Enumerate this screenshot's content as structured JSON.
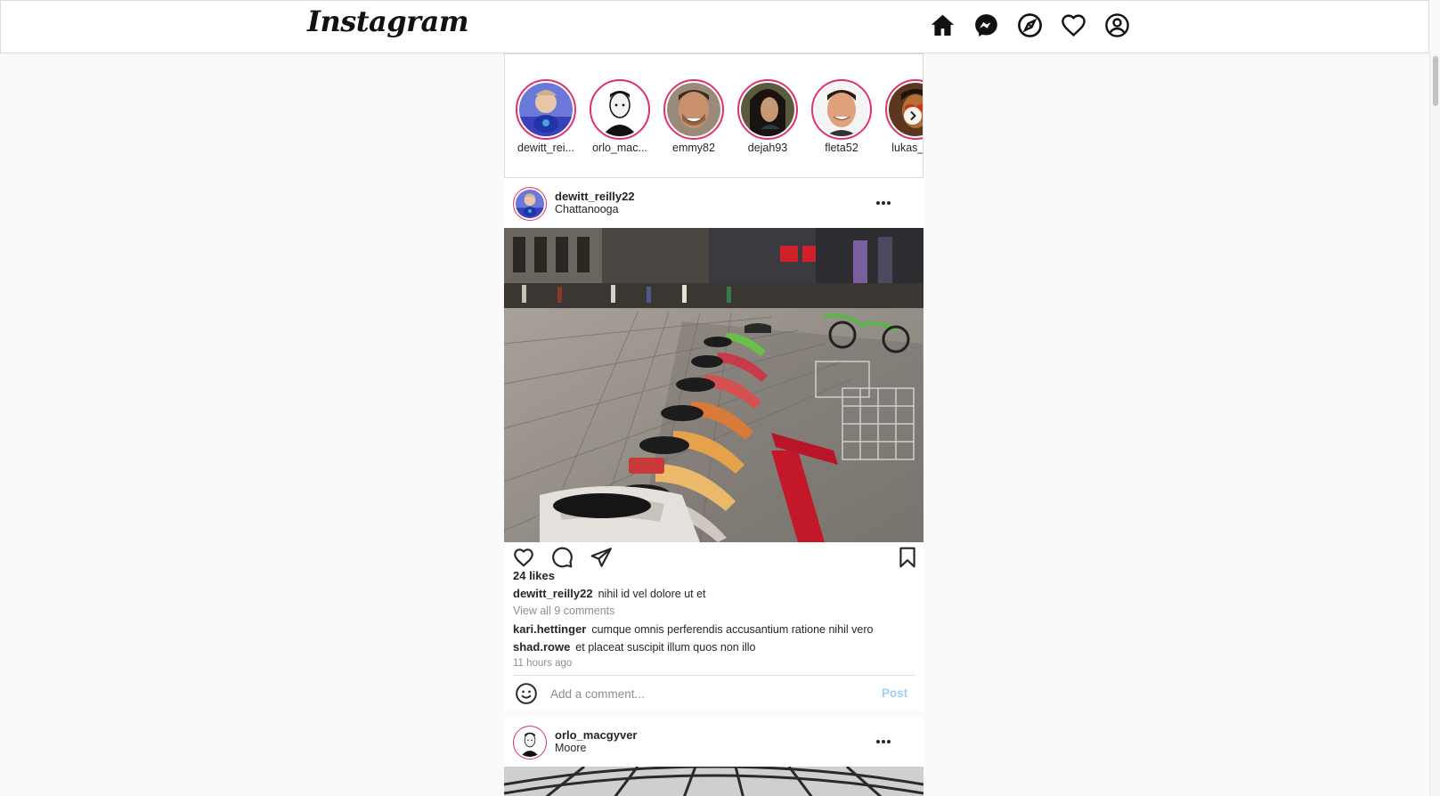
{
  "navbar": {
    "logo": "Instagram",
    "icons": [
      "home-icon",
      "messenger-icon",
      "explore-icon",
      "activity-heart-icon",
      "profile-icon"
    ]
  },
  "stories": [
    {
      "username": "dewitt_rei..."
    },
    {
      "username": "orlo_mac..."
    },
    {
      "username": "emmy82"
    },
    {
      "username": "dejah93"
    },
    {
      "username": "fleta52"
    },
    {
      "username": "lukas_o..."
    }
  ],
  "posts": [
    {
      "username": "dewitt_reilly22",
      "location": "Chattanooga",
      "likes": "24 likes",
      "caption_user": "dewitt_reilly22",
      "caption": "nihil id vel dolore ut et",
      "view_all": "View all 9 comments",
      "comments": [
        {
          "user": "kari.hettinger",
          "text": "cumque omnis perferendis accusantium ratione nihil vero"
        },
        {
          "user": "shad.rowe",
          "text": "et placeat suscipit illum quos non illo"
        }
      ],
      "time": "11 hours ago",
      "comment_placeholder": "Add a comment...",
      "post_button": "Post"
    },
    {
      "username": "orlo_macgyver",
      "location": "Moore"
    }
  ],
  "colors": {
    "story_ring": "#e1306c",
    "post_button": "#9ccff7",
    "muted": "#8e8e8e"
  }
}
